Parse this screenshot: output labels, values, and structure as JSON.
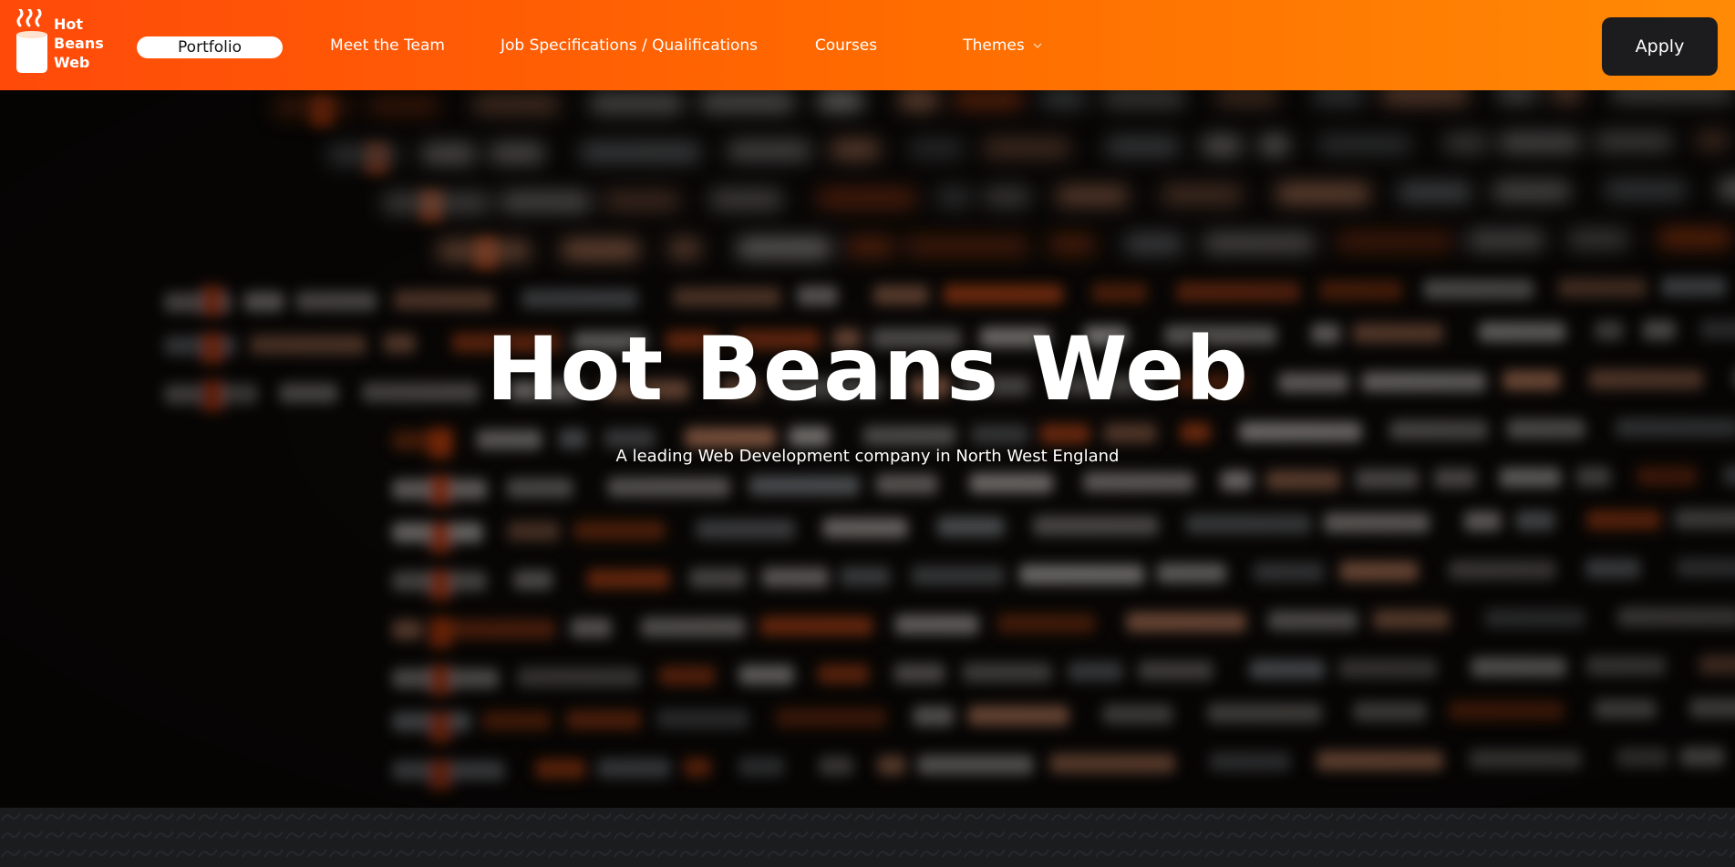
{
  "brand": {
    "name_line1": "Hot",
    "name_line2": "Beans",
    "name_line3": "Web",
    "logo_icon": "coffee-mug-icon",
    "accent_start": "#ff4a0a",
    "accent_end": "#ff8a05"
  },
  "nav": {
    "items": [
      {
        "label": "Portfolio",
        "active": true
      },
      {
        "label": "Meet the Team"
      },
      {
        "label": "Job Specifications / Qualifications"
      },
      {
        "label": "Courses"
      },
      {
        "label": "Themes",
        "icon": "chevron-down-icon"
      }
    ],
    "apply_label": "Apply"
  },
  "hero": {
    "title": "Hot Beans Web",
    "subtitle": "A leading Web Development company in North West England",
    "background": "blurred code screen"
  }
}
